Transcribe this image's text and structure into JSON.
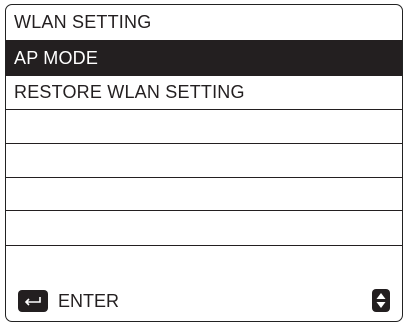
{
  "menu": {
    "title": "WLAN SETTING",
    "items": [
      {
        "label": "AP MODE",
        "selected": true
      },
      {
        "label": "RESTORE WLAN SETTING",
        "selected": false
      },
      {
        "label": "",
        "selected": false
      },
      {
        "label": "",
        "selected": false
      },
      {
        "label": "",
        "selected": false
      },
      {
        "label": "",
        "selected": false
      }
    ]
  },
  "footer": {
    "enter_label": "ENTER",
    "enter_icon": "enter-key-icon",
    "navigate_icon": "up-down-arrows-icon"
  },
  "colors": {
    "foreground": "#231f20",
    "background": "#ffffff",
    "highlight": "#231f20"
  }
}
